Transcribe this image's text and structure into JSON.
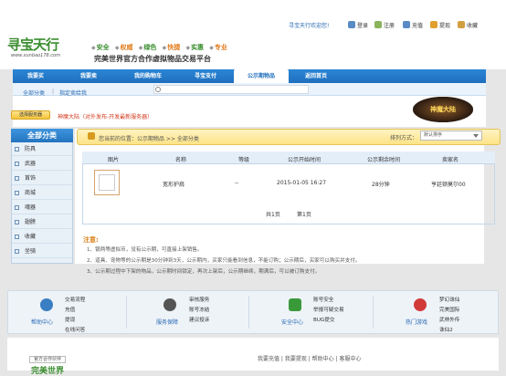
{
  "topbar": {
    "welcome": "寻宝天行欢迎您!",
    "login": "登录",
    "register": "注册",
    "recharge": "充值",
    "withdraw": "提现",
    "favorite": "收藏"
  },
  "header": {
    "logo_text": "寻宝天行",
    "logo_url_text": "www.xunbao178.com",
    "slogans": [
      "安全",
      "权威",
      "绿色",
      "快捷",
      "实惠",
      "专业"
    ],
    "slogan_main": "完美世界官方合作虚拟物品交易平台"
  },
  "nav": {
    "items": [
      "我要买",
      "我要卖",
      "我的购物车",
      "寻宝支付",
      "公示期物品",
      "返回首页"
    ],
    "active_index": 4
  },
  "subnav": {
    "all_categories": "全部分类",
    "specify_seller": "指定卖给我"
  },
  "server": {
    "button": "选择服务器",
    "current": "神魔大陆（对外发布-开发最新服务器）",
    "game_logo": "神魔大陆"
  },
  "sidebar": {
    "title": "全部分类",
    "items": [
      "防具",
      "武器",
      "首饰",
      "商城",
      "魂器",
      "翅膀",
      "收藏",
      "坐骑"
    ]
  },
  "location": {
    "label": "您当前的位置：",
    "path": "公示期物品 >> 全部分类",
    "sort_label": "排列方式：",
    "sort_value": "默认排序"
  },
  "table": {
    "headers": [
      "图片",
      "名称",
      "等级",
      "公示开始时间",
      "公示剩余时间",
      "卖家名"
    ],
    "rows": [
      {
        "name": "宽形护肩",
        "level": "--",
        "start": "2015-01-05 16:27",
        "remaining": "28分钟",
        "seller": "亨廷顿莫尔00"
      }
    ],
    "pager_total": "共1页",
    "pager_current": "第1页"
  },
  "notice": {
    "title": "注意:",
    "lines": [
      "1、银两等虚拟币，没有公示期，可直接上架销售。",
      "2、道具、宠物等的公示期是30分钟到3天，公示期内，买家只能看到信息，不能订购；公示期后，买家可以购买并支付。",
      "3、公示期过程中下架的物品，公示期时间锁定，再次上架后，公示期继续，期满后，可以被订购支付。"
    ]
  },
  "footer": {
    "sections": [
      {
        "label": "帮助中心",
        "links": [
          "交易流程",
          "充值",
          "提现",
          "在线问答"
        ]
      },
      {
        "label": "服务保障",
        "links": [
          "审核服务",
          "账号冻结",
          "建议投诉"
        ]
      },
      {
        "label": "安全中心",
        "links": [
          "账号安全",
          "举报可疑交易",
          "BUG提交"
        ]
      },
      {
        "label": "热门游戏",
        "links": [
          "梦幻诛仙",
          "完美国际",
          "武林外传",
          "诛仙2"
        ]
      }
    ],
    "partners_tag": "官方合作伙伴",
    "partner_logo": "完美世界",
    "bottom_links": "我要充值 | 我要提现 | 帮助中心 | 客服中心"
  },
  "colors": {
    "nav_blue": "#1f6fbd",
    "notice_orange": "#d7821a",
    "server_red": "#d23a1e",
    "logo_green": "#3a8e2f"
  }
}
